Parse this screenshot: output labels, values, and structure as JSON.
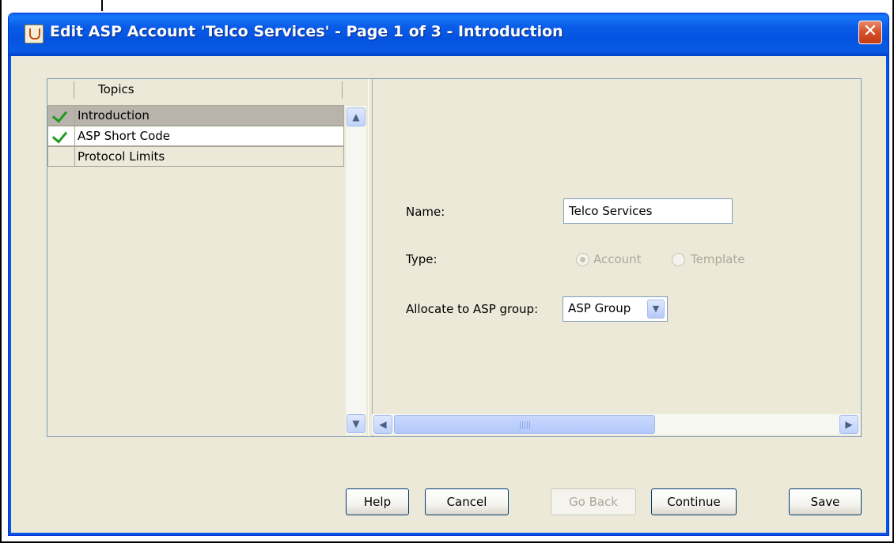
{
  "window": {
    "title": "Edit ASP Account 'Telco Services' - Page 1 of 3 - Introduction",
    "close_glyph": "✕"
  },
  "topics": {
    "header": "Topics",
    "items": [
      {
        "label": "Introduction",
        "checked": true,
        "selected": true
      },
      {
        "label": "ASP Short Code",
        "checked": true,
        "selected": false
      },
      {
        "label": "Protocol Limits",
        "checked": false,
        "selected": false
      }
    ]
  },
  "form": {
    "name_label": "Name:",
    "name_value": "Telco Services",
    "type_label": "Type:",
    "type_options": [
      "Account",
      "Template"
    ],
    "type_selected": "Account",
    "group_label": "Allocate to ASP group:",
    "group_value": "ASP Group"
  },
  "buttons": {
    "help": "Help",
    "cancel": "Cancel",
    "go_back": "Go Back",
    "continue": "Continue",
    "save": "Save"
  },
  "colors": {
    "titlebar": "#0a5de8",
    "dialog_bg": "#ece9d8",
    "check": "#1f9a1f",
    "selected_row": "#b8b4ac"
  }
}
